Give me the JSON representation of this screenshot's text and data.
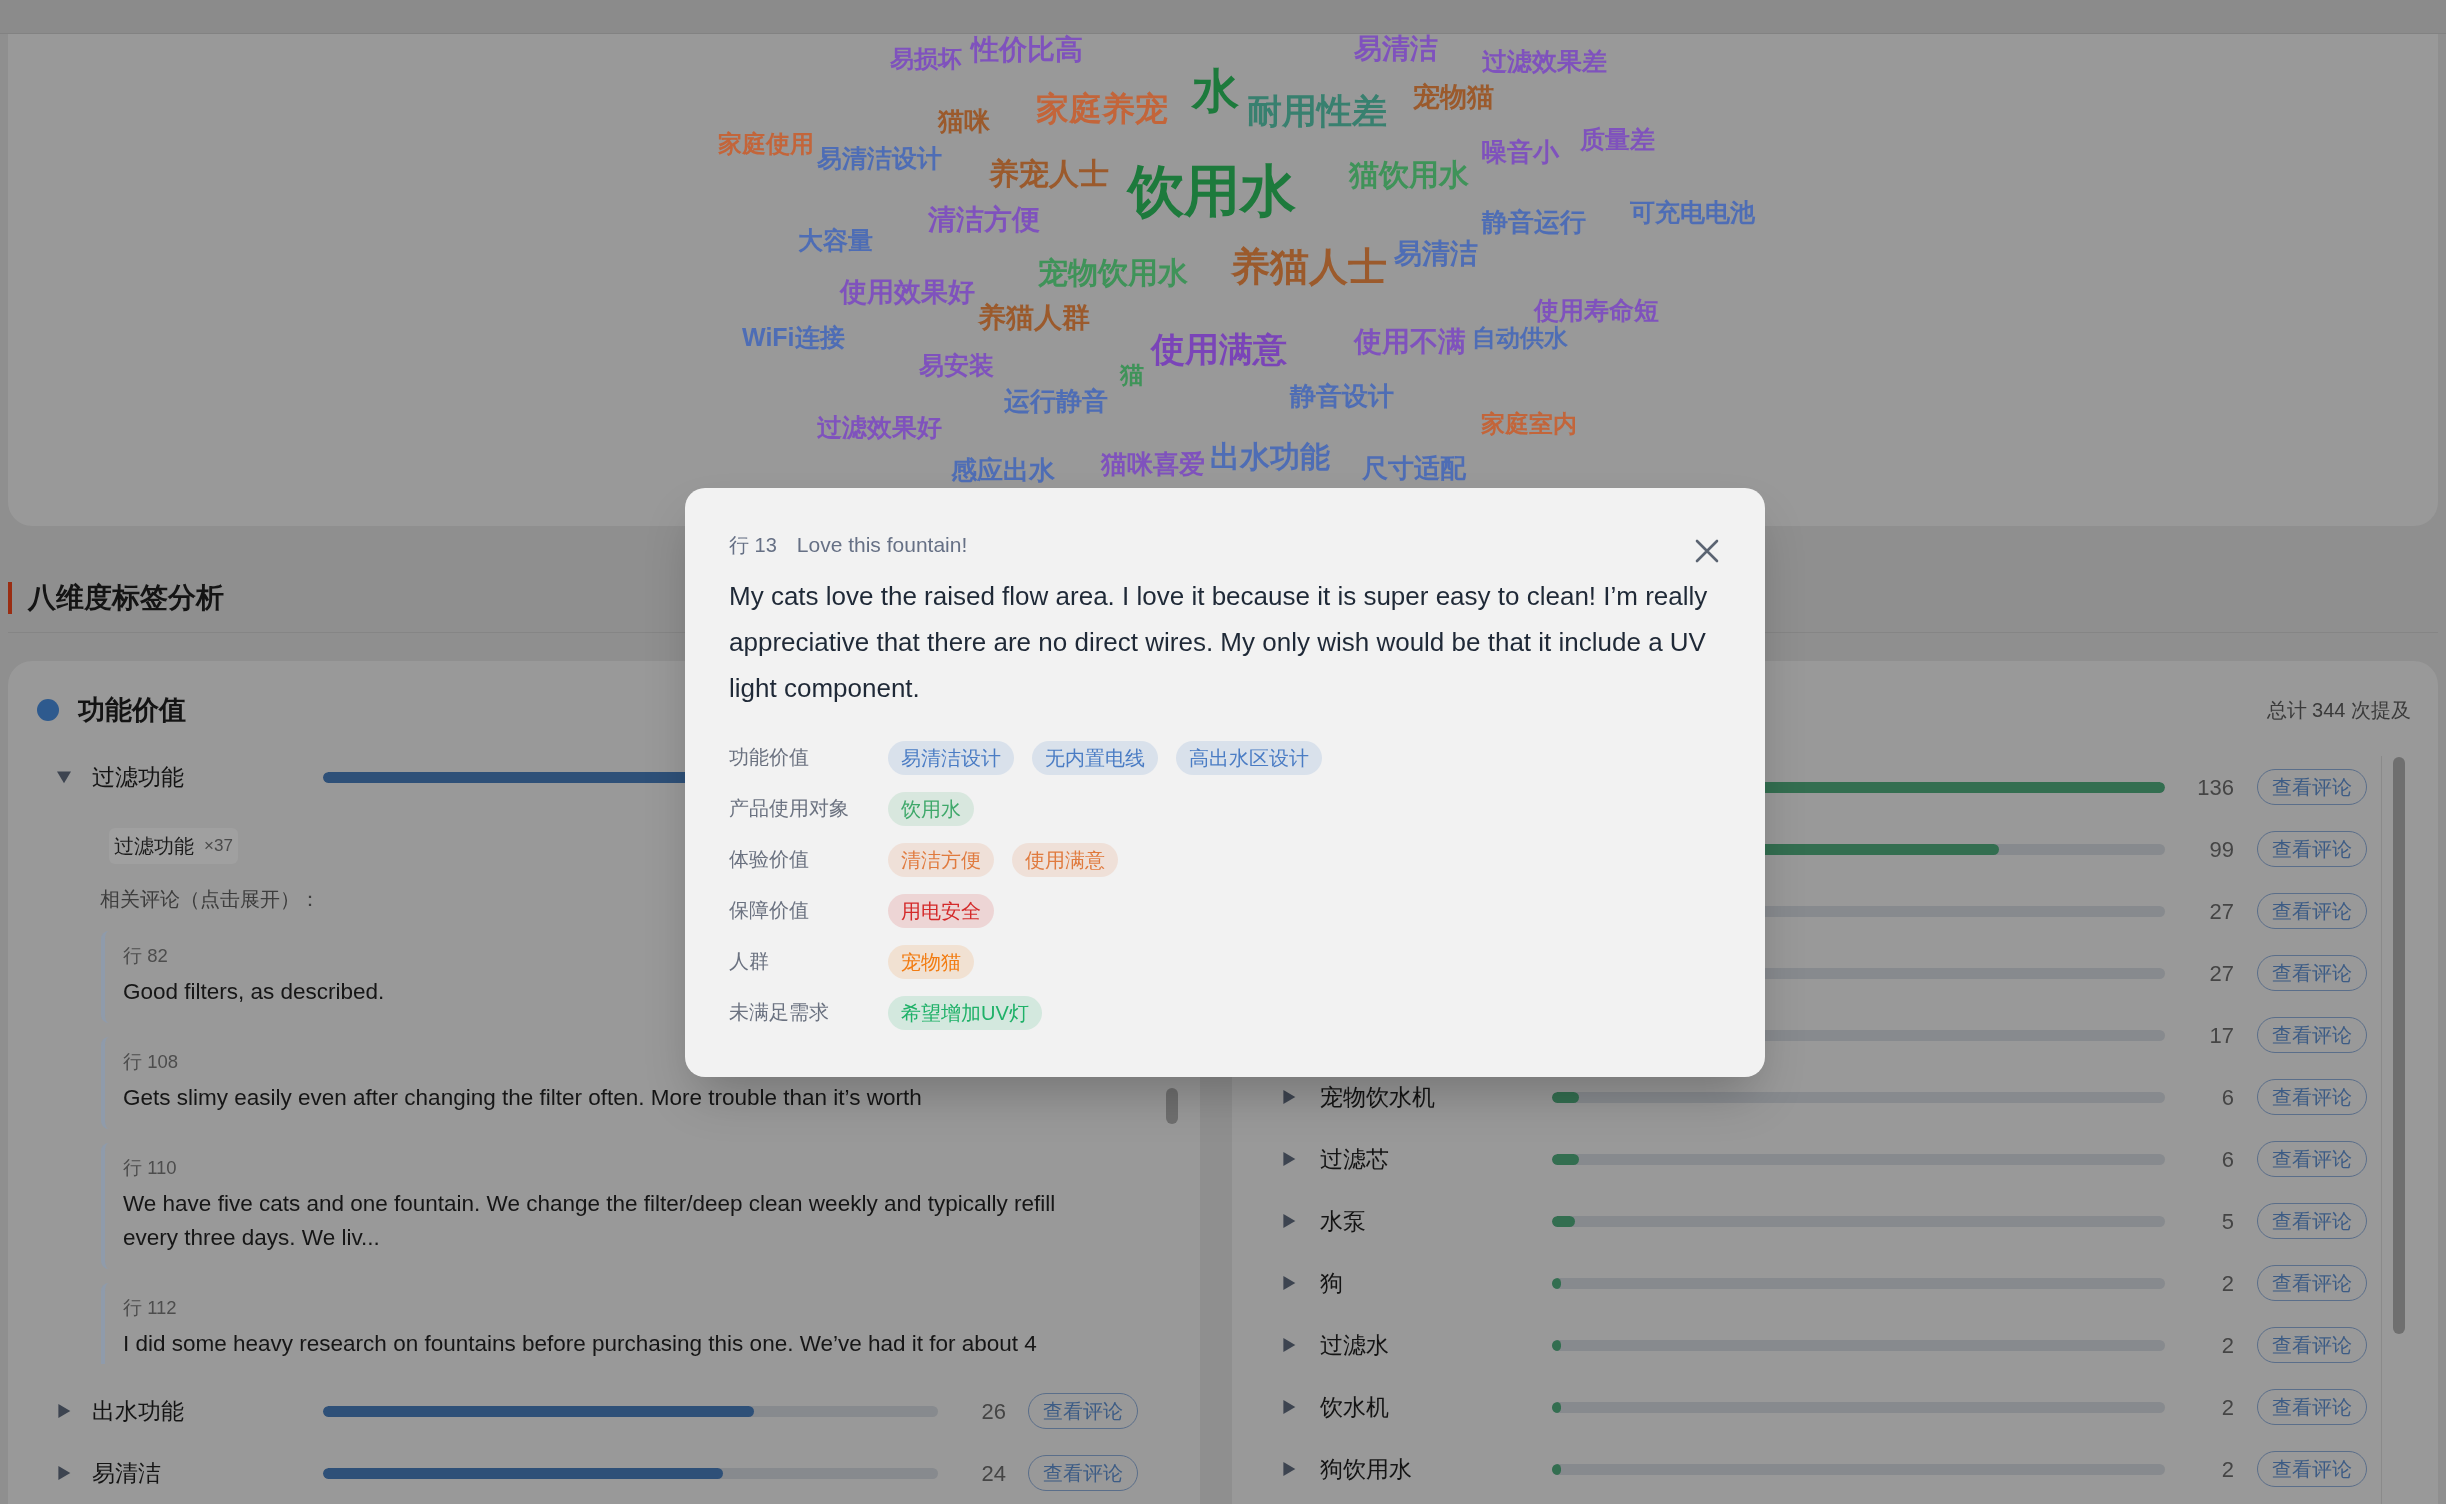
{
  "word_cloud": {
    "words": [
      {
        "text": "易损坏",
        "color": "#7f52bd"
      },
      {
        "text": "性价比高",
        "color": "#7f52bd"
      },
      {
        "text": "易清洁",
        "color": "#7f52bd"
      },
      {
        "text": "过滤效果差",
        "color": "#7f52bd"
      },
      {
        "text": "猫咪",
        "color": "#9b5a2c"
      },
      {
        "text": "家庭养宠",
        "color": "#c3653a"
      },
      {
        "text": "水",
        "color": "#1d7a3c"
      },
      {
        "text": "耐用性差",
        "color": "#38806f"
      },
      {
        "text": "宠物猫",
        "color": "#9b5a2c"
      },
      {
        "text": "家庭使用",
        "color": "#c3653a"
      },
      {
        "text": "易清洁设计",
        "color": "#4e6db5"
      },
      {
        "text": "噪音小",
        "color": "#7f52bd"
      },
      {
        "text": "质量差",
        "color": "#7f52bd"
      },
      {
        "text": "养宠人士",
        "color": "#9b5a2c"
      },
      {
        "text": "饮用水",
        "color": "#1d7a3c"
      },
      {
        "text": "猫饮用水",
        "color": "#3f9359"
      },
      {
        "text": "清洁方便",
        "color": "#7f52bd"
      },
      {
        "text": "静音运行",
        "color": "#4e6db5"
      },
      {
        "text": "可充电电池",
        "color": "#4e6db5"
      },
      {
        "text": "大容量",
        "color": "#4e6db5"
      },
      {
        "text": "宠物饮用水",
        "color": "#3f9359"
      },
      {
        "text": "养猫人士",
        "color": "#9b5a2c"
      },
      {
        "text": "易清洁",
        "color": "#4e6db5"
      },
      {
        "text": "使用效果好",
        "color": "#7f52bd"
      },
      {
        "text": "养猫人群",
        "color": "#9b5a2c"
      },
      {
        "text": "使用寿命短",
        "color": "#7f52bd"
      },
      {
        "text": "WiFi连接",
        "color": "#4e6db5"
      },
      {
        "text": "使用满意",
        "color": "#7a44b8"
      },
      {
        "text": "使用不满",
        "color": "#7f52bd"
      },
      {
        "text": "自动供水",
        "color": "#4e6db5"
      },
      {
        "text": "易安装",
        "color": "#7f52bd"
      },
      {
        "text": "猫",
        "color": "#3f9359"
      },
      {
        "text": "运行静音",
        "color": "#4e6db5"
      },
      {
        "text": "静音设计",
        "color": "#4e6db5"
      },
      {
        "text": "过滤效果好",
        "color": "#7f52bd"
      },
      {
        "text": "家庭室内",
        "color": "#c3653a"
      },
      {
        "text": "感应出水",
        "color": "#4e6db5"
      },
      {
        "text": "猫咪喜爱",
        "color": "#7f52bd"
      },
      {
        "text": "出水功能",
        "color": "#4e6db5"
      },
      {
        "text": "尺寸适配",
        "color": "#4e6db5"
      }
    ]
  },
  "section": {
    "title": "八维度标签分析"
  },
  "left_panel": {
    "title": "功能价值",
    "items": [
      {
        "label": "过滤功能",
        "expanded": true,
        "level": 1,
        "subtags": [
          {
            "label": "过滤功能",
            "count": "×37"
          }
        ],
        "comments_label": "相关评论（点击展开）：",
        "comments": [
          {
            "row": "行 82",
            "text": "Good filters, as described."
          },
          {
            "row": "行 108",
            "text": "Gets slimy easily even after changing the filter often. More trouble than it’s worth"
          },
          {
            "row": "行 110",
            "text": "We have five cats and one fountain. We change the filter/deep clean weekly and typically refill every three days. We liv..."
          },
          {
            "row": "行 112",
            "text": "I did some heavy research on fountains before purchasing this one. We’ve had it for about 4"
          }
        ]
      },
      {
        "label": "出水功能",
        "expanded": false,
        "level": 0.7,
        "count": "26",
        "button": "查看评论"
      },
      {
        "label": "易清洁",
        "expanded": false,
        "level": 0.65,
        "count": "24",
        "button": "查看评论"
      }
    ]
  },
  "right_panel": {
    "total": "总计 344 次提及",
    "items": [
      {
        "level": 1,
        "count": "136",
        "button": "查看评论"
      },
      {
        "level": 0.73,
        "count": "99",
        "button": "查看评论"
      },
      {
        "count": "27",
        "button": "查看评论"
      },
      {
        "count": "27",
        "button": "查看评论"
      },
      {
        "count": "17",
        "button": "查看评论"
      },
      {
        "label": "宠物饮水机",
        "expanded": false,
        "level": 0.044,
        "count": "6",
        "button": "查看评论"
      },
      {
        "label": "过滤芯",
        "expanded": false,
        "level": 0.044,
        "count": "6",
        "button": "查看评论"
      },
      {
        "label": "水泵",
        "expanded": false,
        "level": 0.037,
        "count": "5",
        "button": "查看评论"
      },
      {
        "label": "狗",
        "expanded": false,
        "level": 0.015,
        "count": "2",
        "button": "查看评论"
      },
      {
        "label": "过滤水",
        "expanded": false,
        "level": 0.015,
        "count": "2",
        "button": "查看评论"
      },
      {
        "label": "饮水机",
        "expanded": false,
        "level": 0.015,
        "count": "2",
        "button": "查看评论"
      },
      {
        "label": "狗饮用水",
        "expanded": false,
        "level": 0.015,
        "count": "2",
        "button": "查看评论"
      }
    ]
  },
  "modal": {
    "row": "行 13",
    "title": "Love this fountain!",
    "text": "My cats love the raised flow area. I love it because it is super easy to clean! I’m really appreciative that there are no direct wires. My only wish would be that it include a UV light component.",
    "tag_groups": [
      {
        "label": "功能价值",
        "color": "#4a7cc4",
        "tags": [
          "易清洁设计",
          "无内置电线",
          "高出水区设计"
        ]
      },
      {
        "label": "产品使用对象",
        "color": "#3fa86a",
        "tags": [
          "饮用水"
        ]
      },
      {
        "label": "体验价值",
        "color": "#e07a3e",
        "tags": [
          "清洁方便",
          "使用满意"
        ]
      },
      {
        "label": "保障价值",
        "color": "#d42a2a",
        "tags": [
          "用电安全"
        ]
      },
      {
        "label": "人群",
        "color": "#f27c12",
        "tags": [
          "宠物猫"
        ]
      },
      {
        "label": "未满足需求",
        "color": "#1fb168",
        "tags": [
          "希望增加UV灯"
        ]
      }
    ]
  }
}
